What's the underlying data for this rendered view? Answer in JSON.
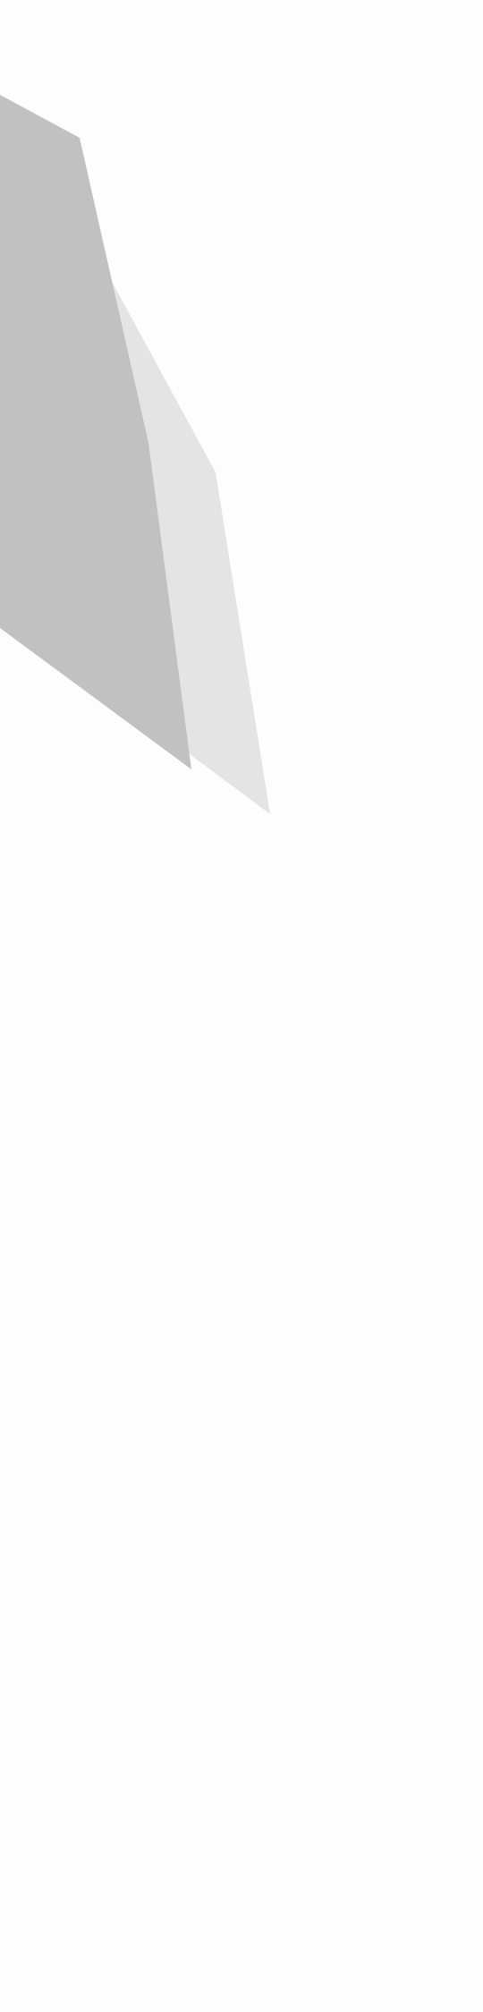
{
  "colors": {
    "background": "#fdfdfd",
    "back_shape": "#e4e4e4",
    "front_shape": "#c1c1c1"
  }
}
